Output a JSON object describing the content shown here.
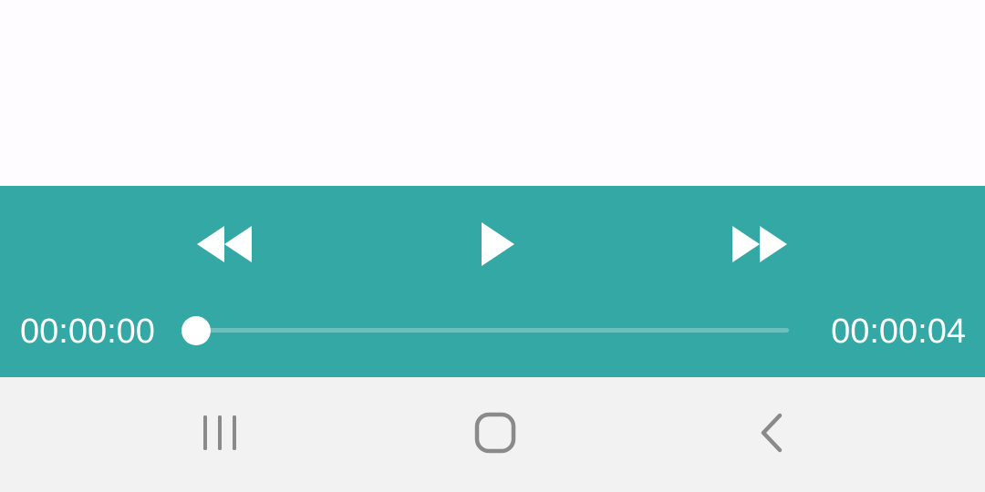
{
  "player": {
    "current_time": "00:00:00",
    "total_time": "00:00:04",
    "progress_fraction": 0.0,
    "accent_color": "#33a8a5",
    "icons": {
      "rewind": "rewind-icon",
      "play": "play-icon",
      "forward": "fast-forward-icon"
    }
  },
  "nav_bar": {
    "icons": {
      "recents": "recents-icon",
      "home": "home-icon",
      "back": "back-icon"
    },
    "background": "#f2f2f2"
  }
}
